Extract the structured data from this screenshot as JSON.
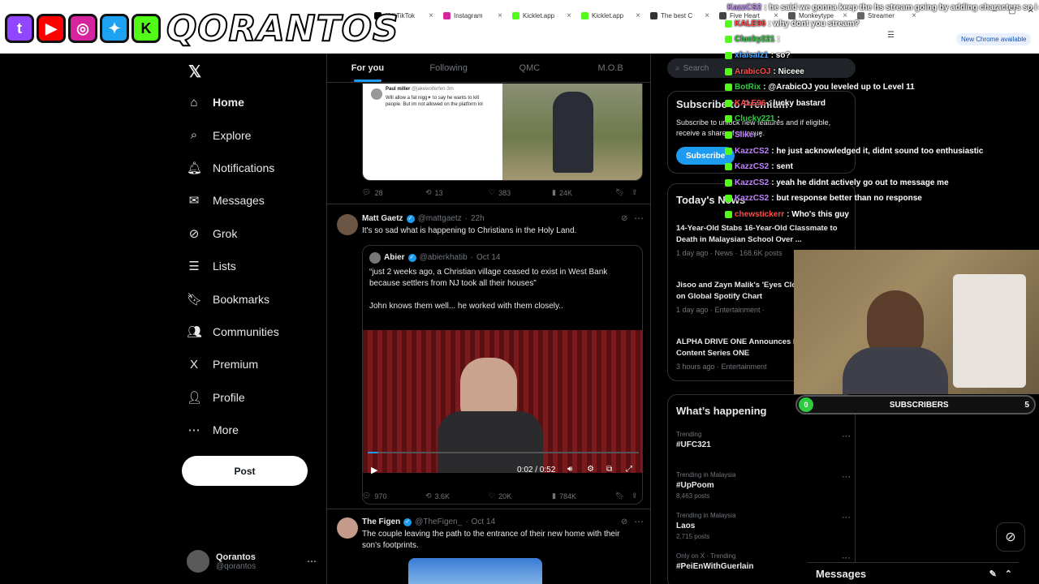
{
  "browser": {
    "tabs": [
      {
        "label": "(44)TikTok"
      },
      {
        "label": "Instagram"
      },
      {
        "label": "Kicklet.app"
      },
      {
        "label": "Kicklet.app"
      },
      {
        "label": "The best C"
      },
      {
        "label": "Five Heart"
      },
      {
        "label": "Monkeytype"
      },
      {
        "label": "Streamer"
      }
    ],
    "new_chrome": "New Chrome available"
  },
  "banner": {
    "title": "QORANTOS",
    "colors": {
      "twitch": "#9146ff",
      "youtube": "#ff0000",
      "instagram": "#d6249f",
      "twitter": "#1da1f2",
      "kick": "#53fc18"
    }
  },
  "sidebar": {
    "items": [
      {
        "label": "Home",
        "icon": "home-icon",
        "glyph": "⌂"
      },
      {
        "label": "Explore",
        "icon": "search-icon",
        "glyph": "⌕"
      },
      {
        "label": "Notifications",
        "icon": "bell-icon",
        "glyph": "🔔︎"
      },
      {
        "label": "Messages",
        "icon": "mail-icon",
        "glyph": "✉"
      },
      {
        "label": "Grok",
        "icon": "grok-icon",
        "glyph": "⊘"
      },
      {
        "label": "Lists",
        "icon": "list-icon",
        "glyph": "☰"
      },
      {
        "label": "Bookmarks",
        "icon": "bookmark-icon",
        "glyph": "🔖︎"
      },
      {
        "label": "Communities",
        "icon": "people-icon",
        "glyph": "👥︎"
      },
      {
        "label": "Premium",
        "icon": "x-icon",
        "glyph": "X"
      },
      {
        "label": "Profile",
        "icon": "person-icon",
        "glyph": "👤︎"
      },
      {
        "label": "More",
        "icon": "more-icon",
        "glyph": "⋯"
      }
    ],
    "post_label": "Post",
    "account": {
      "name": "Qorantos",
      "handle": "@qorantos"
    }
  },
  "feed": {
    "tabs": [
      "For you",
      "Following",
      "QMC",
      "M.O.B"
    ],
    "t0": {
      "quote_name": "Paul miller",
      "quote_handle": "@jakewolferfen·3m",
      "quote_text": "Will allow a fat nigg✶ to say he wants to kill people. But im not allowed on the platform lol",
      "replies": "28",
      "reposts": "13",
      "likes": "383",
      "views": "24K"
    },
    "t1": {
      "name": "Matt Gaetz",
      "handle": "@mattgaetz",
      "time": "22h",
      "text": "It's so sad what is happening to Christians in the Holy Land.",
      "quote_name": "Abier",
      "quote_handle": "@abierkhatib",
      "quote_time": "Oct 14",
      "quote_text1": "“just 2 weeks ago, a Christian village ceased to exist in West Bank because settlers from NJ took all their houses”",
      "quote_text2": "John knows them well... he  worked with them closely..",
      "video_time": "0:02 / 0:52",
      "replies": "970",
      "reposts": "3.6K",
      "likes": "20K",
      "views": "784K"
    },
    "t2": {
      "name": "The Figen",
      "handle": "@TheFigen_",
      "time": "Oct 14",
      "text": "The couple leaving the path to the entrance of their new home with their son's footprints."
    }
  },
  "right": {
    "search": "Search",
    "premium": {
      "title": "Subscribe to Premium",
      "desc": "Subscribe to unlock new features and if eligible, receive a share of revenue.",
      "button": "Subscribe"
    },
    "news": {
      "title": "Today's News",
      "items": [
        {
          "headline": "14-Year-Old Stabs 16-Year-Old Classmate to Death in Malaysian School Over ...",
          "meta": "1 day ago · News · 168.6K posts"
        },
        {
          "headline": "Jisoo and Zayn Malik's 'Eyes Closed' at No. 1 on Global Spotify Chart",
          "meta": "1 day ago · Entertainment ·"
        },
        {
          "headline": "ALPHA DRIVE ONE Announces Produced Content Series ONE",
          "meta": "3 hours ago · Entertainment"
        }
      ]
    },
    "happening": {
      "title": "What’s happening",
      "items": [
        {
          "cat": "Trending",
          "tag": "#UFC321",
          "posts": ""
        },
        {
          "cat": "Trending in Malaysia",
          "tag": "#UpPoom",
          "posts": "8,463 posts"
        },
        {
          "cat": "Trending in Malaysia",
          "tag": "Laos",
          "posts": "2,715 posts"
        },
        {
          "cat": "Only on X · Trending",
          "tag": "#PeiEnWithGuerlain",
          "posts": ""
        }
      ]
    },
    "messages": "Messages"
  },
  "overlay": {
    "chat": [
      {
        "user": "KazzCS2",
        "color": "#c084fc",
        "msg": ": he said we gonna keep the hs stream going by adding characters so i messaged him the proposal"
      },
      {
        "user": "KALE96",
        "color": "#ff4d4d",
        "msg": ": why dont you stream?"
      },
      {
        "user": "Clucky221",
        "color": "#2ecc40",
        "msg": ":"
      },
      {
        "user": "xfaisalz1",
        "color": "#4da6ff",
        "msg": ": so?"
      },
      {
        "user": "ArabicOJ",
        "color": "#ff4d4d",
        "msg": ": Niceee"
      },
      {
        "user": "BotRix",
        "color": "#2ecc40",
        "msg": ": @ArabicOJ you leveled up to Level 11"
      },
      {
        "user": "KALE96",
        "color": "#ff4d4d",
        "msg": ": lucky bastard"
      },
      {
        "user": "Clucky221",
        "color": "#2ecc40",
        "msg": ":"
      },
      {
        "user": "Sliker",
        "color": "#c084fc",
        "msg": ":"
      },
      {
        "user": "KazzCS2",
        "color": "#c084fc",
        "msg": ": he just acknowledged it, didnt sound too enthusiastic"
      },
      {
        "user": "KazzCS2",
        "color": "#c084fc",
        "msg": ": sent"
      },
      {
        "user": "KazzCS2",
        "color": "#c084fc",
        "msg": ": yeah he didnt actively go out to message me"
      },
      {
        "user": "KazzCS2",
        "color": "#c084fc",
        "msg": ": but response better than no response"
      },
      {
        "user": "chewstickerr",
        "color": "#ff4d4d",
        "msg": ": Who's this guy"
      }
    ],
    "subs": {
      "label": "SUBSCRIBERS",
      "current": "0",
      "goal": "5",
      "progress": 0
    }
  }
}
